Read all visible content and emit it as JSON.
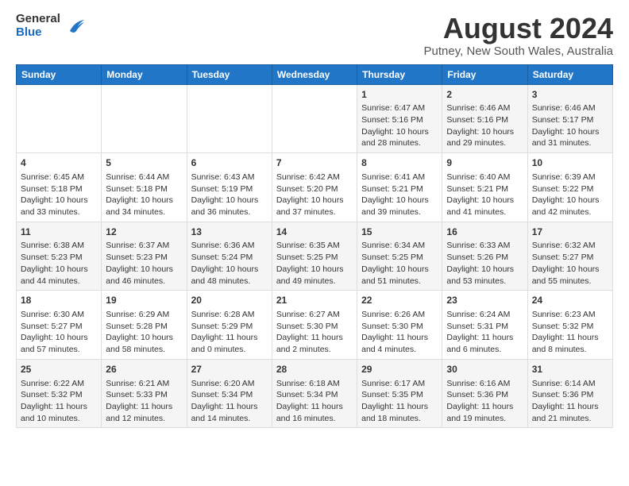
{
  "logo": {
    "general": "General",
    "blue": "Blue"
  },
  "title": "August 2024",
  "subtitle": "Putney, New South Wales, Australia",
  "calendar": {
    "headers": [
      "Sunday",
      "Monday",
      "Tuesday",
      "Wednesday",
      "Thursday",
      "Friday",
      "Saturday"
    ],
    "weeks": [
      [
        {
          "day": "",
          "content": ""
        },
        {
          "day": "",
          "content": ""
        },
        {
          "day": "",
          "content": ""
        },
        {
          "day": "",
          "content": ""
        },
        {
          "day": "1",
          "content": "Sunrise: 6:47 AM\nSunset: 5:16 PM\nDaylight: 10 hours\nand 28 minutes."
        },
        {
          "day": "2",
          "content": "Sunrise: 6:46 AM\nSunset: 5:16 PM\nDaylight: 10 hours\nand 29 minutes."
        },
        {
          "day": "3",
          "content": "Sunrise: 6:46 AM\nSunset: 5:17 PM\nDaylight: 10 hours\nand 31 minutes."
        }
      ],
      [
        {
          "day": "4",
          "content": "Sunrise: 6:45 AM\nSunset: 5:18 PM\nDaylight: 10 hours\nand 33 minutes."
        },
        {
          "day": "5",
          "content": "Sunrise: 6:44 AM\nSunset: 5:18 PM\nDaylight: 10 hours\nand 34 minutes."
        },
        {
          "day": "6",
          "content": "Sunrise: 6:43 AM\nSunset: 5:19 PM\nDaylight: 10 hours\nand 36 minutes."
        },
        {
          "day": "7",
          "content": "Sunrise: 6:42 AM\nSunset: 5:20 PM\nDaylight: 10 hours\nand 37 minutes."
        },
        {
          "day": "8",
          "content": "Sunrise: 6:41 AM\nSunset: 5:21 PM\nDaylight: 10 hours\nand 39 minutes."
        },
        {
          "day": "9",
          "content": "Sunrise: 6:40 AM\nSunset: 5:21 PM\nDaylight: 10 hours\nand 41 minutes."
        },
        {
          "day": "10",
          "content": "Sunrise: 6:39 AM\nSunset: 5:22 PM\nDaylight: 10 hours\nand 42 minutes."
        }
      ],
      [
        {
          "day": "11",
          "content": "Sunrise: 6:38 AM\nSunset: 5:23 PM\nDaylight: 10 hours\nand 44 minutes."
        },
        {
          "day": "12",
          "content": "Sunrise: 6:37 AM\nSunset: 5:23 PM\nDaylight: 10 hours\nand 46 minutes."
        },
        {
          "day": "13",
          "content": "Sunrise: 6:36 AM\nSunset: 5:24 PM\nDaylight: 10 hours\nand 48 minutes."
        },
        {
          "day": "14",
          "content": "Sunrise: 6:35 AM\nSunset: 5:25 PM\nDaylight: 10 hours\nand 49 minutes."
        },
        {
          "day": "15",
          "content": "Sunrise: 6:34 AM\nSunset: 5:25 PM\nDaylight: 10 hours\nand 51 minutes."
        },
        {
          "day": "16",
          "content": "Sunrise: 6:33 AM\nSunset: 5:26 PM\nDaylight: 10 hours\nand 53 minutes."
        },
        {
          "day": "17",
          "content": "Sunrise: 6:32 AM\nSunset: 5:27 PM\nDaylight: 10 hours\nand 55 minutes."
        }
      ],
      [
        {
          "day": "18",
          "content": "Sunrise: 6:30 AM\nSunset: 5:27 PM\nDaylight: 10 hours\nand 57 minutes."
        },
        {
          "day": "19",
          "content": "Sunrise: 6:29 AM\nSunset: 5:28 PM\nDaylight: 10 hours\nand 58 minutes."
        },
        {
          "day": "20",
          "content": "Sunrise: 6:28 AM\nSunset: 5:29 PM\nDaylight: 11 hours\nand 0 minutes."
        },
        {
          "day": "21",
          "content": "Sunrise: 6:27 AM\nSunset: 5:30 PM\nDaylight: 11 hours\nand 2 minutes."
        },
        {
          "day": "22",
          "content": "Sunrise: 6:26 AM\nSunset: 5:30 PM\nDaylight: 11 hours\nand 4 minutes."
        },
        {
          "day": "23",
          "content": "Sunrise: 6:24 AM\nSunset: 5:31 PM\nDaylight: 11 hours\nand 6 minutes."
        },
        {
          "day": "24",
          "content": "Sunrise: 6:23 AM\nSunset: 5:32 PM\nDaylight: 11 hours\nand 8 minutes."
        }
      ],
      [
        {
          "day": "25",
          "content": "Sunrise: 6:22 AM\nSunset: 5:32 PM\nDaylight: 11 hours\nand 10 minutes."
        },
        {
          "day": "26",
          "content": "Sunrise: 6:21 AM\nSunset: 5:33 PM\nDaylight: 11 hours\nand 12 minutes."
        },
        {
          "day": "27",
          "content": "Sunrise: 6:20 AM\nSunset: 5:34 PM\nDaylight: 11 hours\nand 14 minutes."
        },
        {
          "day": "28",
          "content": "Sunrise: 6:18 AM\nSunset: 5:34 PM\nDaylight: 11 hours\nand 16 minutes."
        },
        {
          "day": "29",
          "content": "Sunrise: 6:17 AM\nSunset: 5:35 PM\nDaylight: 11 hours\nand 18 minutes."
        },
        {
          "day": "30",
          "content": "Sunrise: 6:16 AM\nSunset: 5:36 PM\nDaylight: 11 hours\nand 19 minutes."
        },
        {
          "day": "31",
          "content": "Sunrise: 6:14 AM\nSunset: 5:36 PM\nDaylight: 11 hours\nand 21 minutes."
        }
      ]
    ]
  }
}
